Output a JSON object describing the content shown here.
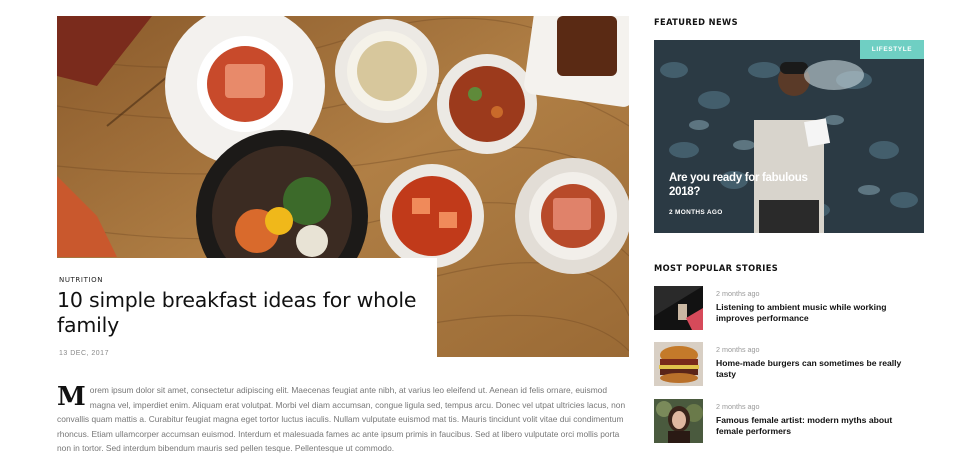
{
  "post": {
    "category": "NUTRITION",
    "title": "10 simple breakfast ideas for whole family",
    "date": "13 DEC, 2017",
    "drop_cap": "M",
    "body": "orem ipsum dolor sit amet, consectetur adipiscing elit. Maecenas feugiat ante nibh, at varius leo eleifend ut. Aenean id felis ornare, euismod magna vel, imperdiet enim. Aliquam erat volutpat. Morbi vel diam accumsan, congue ligula sed, tempus arcu. Donec vel utpat ultricies lacus, non convallis quam mattis a. Curabitur feugiat magna eget tortor luctus iaculis. Nullam vulputate euismod mat tis. Mauris tincidunt volit vitae dui condimentum rhoncus. Etiam ullamcorper accumsan euismod. Interdum et malesuada fames ac ante ipsum primis in faucibus. Sed at libero vulputate orci mollis porta non in tortor. Sed interdum bibendum mauris sed pellen tesque. Pellentesque ut commodo."
  },
  "sidebar": {
    "featured_heading": "FEATURED NEWS",
    "featured": {
      "badge": "LIFESTYLE",
      "headline": "Are you ready for fabulous 2018?",
      "age": "2 MONTHS AGO"
    },
    "popular_heading": "MOST POPULAR STORIES",
    "stories": [
      {
        "age": "2 months ago",
        "headline": "Listening to ambient music while working improves performance"
      },
      {
        "age": "2 months ago",
        "headline": "Home-made burgers can sometimes be really tasty"
      },
      {
        "age": "2 months ago",
        "headline": "Famous female artist: modern myths about female performers"
      }
    ]
  },
  "colors": {
    "badge": "#6fcfc3",
    "text": "#111111",
    "muted": "#777777"
  }
}
